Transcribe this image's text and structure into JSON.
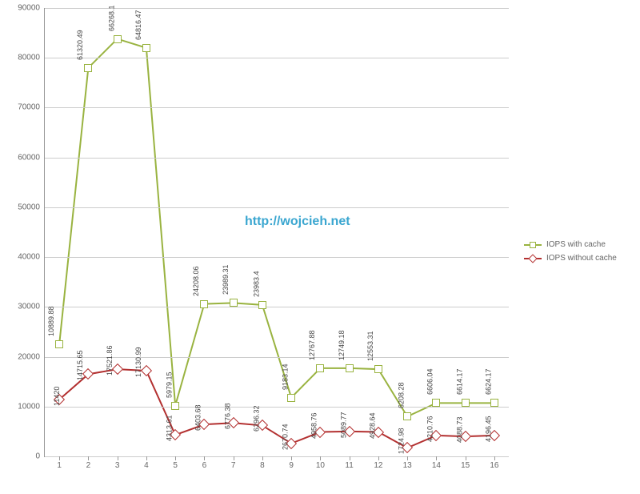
{
  "chart_data": {
    "type": "line",
    "categories": [
      "1",
      "2",
      "3",
      "4",
      "5",
      "6",
      "7",
      "8",
      "9",
      "10",
      "11",
      "12",
      "13",
      "14",
      "15",
      "16"
    ],
    "series": [
      {
        "name": "IOPS with cache",
        "color": "#99b340",
        "marker": "square",
        "values": [
          22500,
          78000,
          83800,
          82000,
          10200,
          30600,
          30800,
          30400,
          11800,
          17700,
          17700,
          17500,
          8000,
          10700,
          10700,
          10700
        ],
        "labels": [
          "10889.88",
          "61320.49",
          "66268.1",
          "64816.47",
          "5979.15",
          "24208.06",
          "23989.31",
          "23983.4",
          "9183.14",
          "12767.88",
          "12749.18",
          "12553.31",
          "6208.28",
          "6606.04",
          "6614.17",
          "6624.17"
        ]
      },
      {
        "name": "IOPS without cache",
        "color": "#b33030",
        "marker": "diamond",
        "values": [
          11420,
          16500,
          17500,
          17200,
          4300,
          6400,
          6700,
          6200,
          2600,
          4900,
          5000,
          4900,
          1700,
          4200,
          4000,
          4200
        ],
        "labels": [
          "11420",
          "14715.65",
          "17521.86",
          "17130.99",
          "4313.61",
          "6403.68",
          "6776.38",
          "6296.32",
          "2670.74",
          "4958.76",
          "5089.77",
          "4928.64",
          "1724.98",
          "4210.76",
          "4088.73",
          "4196.45"
        ]
      }
    ],
    "ylim": [
      0,
      90000
    ],
    "ytick_step": 10000,
    "xlabel": "",
    "ylabel": "",
    "title": ""
  },
  "watermark": "http://wojcieh.net",
  "legend": {
    "s0": "IOPS with cache",
    "s1": "IOPS without cache"
  }
}
